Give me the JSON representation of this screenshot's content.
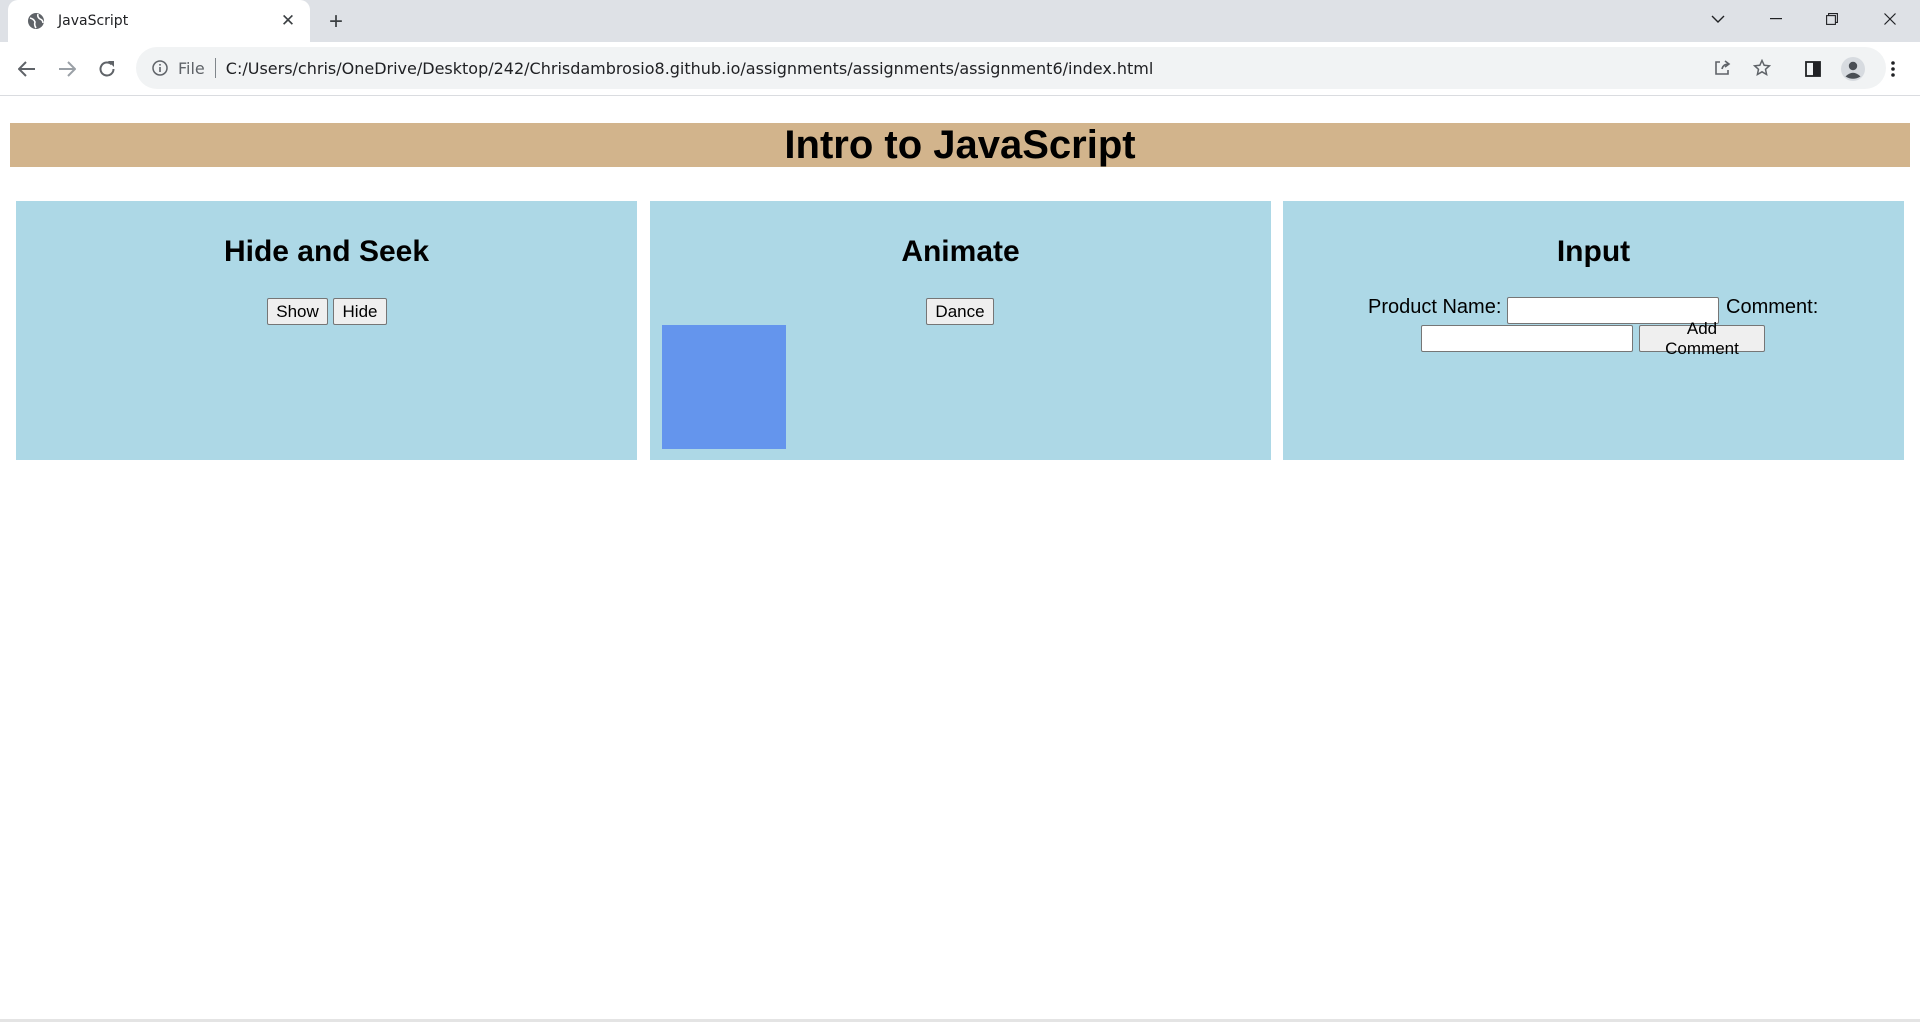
{
  "browser": {
    "tab_title": "JavaScript",
    "url_scheme_label": "File",
    "url": "C:/Users/chris/OneDrive/Desktop/242/Chrisdambrosio8.github.io/assignments/assignments/assignment6/index.html"
  },
  "page": {
    "title": "Intro to JavaScript",
    "hide_seek": {
      "heading": "Hide and Seek",
      "show_label": "Show",
      "hide_label": "Hide"
    },
    "animate": {
      "heading": "Animate",
      "dance_label": "Dance"
    },
    "input": {
      "heading": "Input",
      "product_label": "Product Name:",
      "product_value": "",
      "comment_label": "Comment:",
      "comment_value": "",
      "add_label": "Add Comment"
    }
  },
  "colors": {
    "banner": "#d2b48c",
    "panel": "#add8e6",
    "square": "#6495ed"
  },
  "icons": [
    "globe-icon",
    "close-icon",
    "plus-icon",
    "chevron-down-icon",
    "minimize-icon",
    "restore-icon",
    "close-window-icon",
    "back-arrow-icon",
    "forward-arrow-icon",
    "reload-icon",
    "info-icon",
    "share-icon",
    "star-icon",
    "side-panel-icon",
    "profile-icon",
    "kebab-menu-icon"
  ]
}
